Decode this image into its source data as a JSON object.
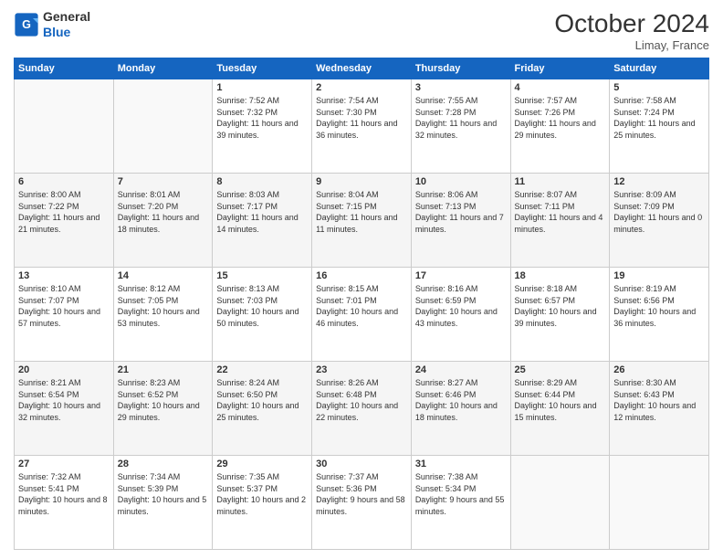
{
  "header": {
    "logo_line1": "General",
    "logo_line2": "Blue",
    "month": "October 2024",
    "location": "Limay, France"
  },
  "days_of_week": [
    "Sunday",
    "Monday",
    "Tuesday",
    "Wednesday",
    "Thursday",
    "Friday",
    "Saturday"
  ],
  "weeks": [
    [
      {
        "day": "",
        "sunrise": "",
        "sunset": "",
        "daylight": ""
      },
      {
        "day": "",
        "sunrise": "",
        "sunset": "",
        "daylight": ""
      },
      {
        "day": "1",
        "sunrise": "Sunrise: 7:52 AM",
        "sunset": "Sunset: 7:32 PM",
        "daylight": "Daylight: 11 hours and 39 minutes."
      },
      {
        "day": "2",
        "sunrise": "Sunrise: 7:54 AM",
        "sunset": "Sunset: 7:30 PM",
        "daylight": "Daylight: 11 hours and 36 minutes."
      },
      {
        "day": "3",
        "sunrise": "Sunrise: 7:55 AM",
        "sunset": "Sunset: 7:28 PM",
        "daylight": "Daylight: 11 hours and 32 minutes."
      },
      {
        "day": "4",
        "sunrise": "Sunrise: 7:57 AM",
        "sunset": "Sunset: 7:26 PM",
        "daylight": "Daylight: 11 hours and 29 minutes."
      },
      {
        "day": "5",
        "sunrise": "Sunrise: 7:58 AM",
        "sunset": "Sunset: 7:24 PM",
        "daylight": "Daylight: 11 hours and 25 minutes."
      }
    ],
    [
      {
        "day": "6",
        "sunrise": "Sunrise: 8:00 AM",
        "sunset": "Sunset: 7:22 PM",
        "daylight": "Daylight: 11 hours and 21 minutes."
      },
      {
        "day": "7",
        "sunrise": "Sunrise: 8:01 AM",
        "sunset": "Sunset: 7:20 PM",
        "daylight": "Daylight: 11 hours and 18 minutes."
      },
      {
        "day": "8",
        "sunrise": "Sunrise: 8:03 AM",
        "sunset": "Sunset: 7:17 PM",
        "daylight": "Daylight: 11 hours and 14 minutes."
      },
      {
        "day": "9",
        "sunrise": "Sunrise: 8:04 AM",
        "sunset": "Sunset: 7:15 PM",
        "daylight": "Daylight: 11 hours and 11 minutes."
      },
      {
        "day": "10",
        "sunrise": "Sunrise: 8:06 AM",
        "sunset": "Sunset: 7:13 PM",
        "daylight": "Daylight: 11 hours and 7 minutes."
      },
      {
        "day": "11",
        "sunrise": "Sunrise: 8:07 AM",
        "sunset": "Sunset: 7:11 PM",
        "daylight": "Daylight: 11 hours and 4 minutes."
      },
      {
        "day": "12",
        "sunrise": "Sunrise: 8:09 AM",
        "sunset": "Sunset: 7:09 PM",
        "daylight": "Daylight: 11 hours and 0 minutes."
      }
    ],
    [
      {
        "day": "13",
        "sunrise": "Sunrise: 8:10 AM",
        "sunset": "Sunset: 7:07 PM",
        "daylight": "Daylight: 10 hours and 57 minutes."
      },
      {
        "day": "14",
        "sunrise": "Sunrise: 8:12 AM",
        "sunset": "Sunset: 7:05 PM",
        "daylight": "Daylight: 10 hours and 53 minutes."
      },
      {
        "day": "15",
        "sunrise": "Sunrise: 8:13 AM",
        "sunset": "Sunset: 7:03 PM",
        "daylight": "Daylight: 10 hours and 50 minutes."
      },
      {
        "day": "16",
        "sunrise": "Sunrise: 8:15 AM",
        "sunset": "Sunset: 7:01 PM",
        "daylight": "Daylight: 10 hours and 46 minutes."
      },
      {
        "day": "17",
        "sunrise": "Sunrise: 8:16 AM",
        "sunset": "Sunset: 6:59 PM",
        "daylight": "Daylight: 10 hours and 43 minutes."
      },
      {
        "day": "18",
        "sunrise": "Sunrise: 8:18 AM",
        "sunset": "Sunset: 6:57 PM",
        "daylight": "Daylight: 10 hours and 39 minutes."
      },
      {
        "day": "19",
        "sunrise": "Sunrise: 8:19 AM",
        "sunset": "Sunset: 6:56 PM",
        "daylight": "Daylight: 10 hours and 36 minutes."
      }
    ],
    [
      {
        "day": "20",
        "sunrise": "Sunrise: 8:21 AM",
        "sunset": "Sunset: 6:54 PM",
        "daylight": "Daylight: 10 hours and 32 minutes."
      },
      {
        "day": "21",
        "sunrise": "Sunrise: 8:23 AM",
        "sunset": "Sunset: 6:52 PM",
        "daylight": "Daylight: 10 hours and 29 minutes."
      },
      {
        "day": "22",
        "sunrise": "Sunrise: 8:24 AM",
        "sunset": "Sunset: 6:50 PM",
        "daylight": "Daylight: 10 hours and 25 minutes."
      },
      {
        "day": "23",
        "sunrise": "Sunrise: 8:26 AM",
        "sunset": "Sunset: 6:48 PM",
        "daylight": "Daylight: 10 hours and 22 minutes."
      },
      {
        "day": "24",
        "sunrise": "Sunrise: 8:27 AM",
        "sunset": "Sunset: 6:46 PM",
        "daylight": "Daylight: 10 hours and 18 minutes."
      },
      {
        "day": "25",
        "sunrise": "Sunrise: 8:29 AM",
        "sunset": "Sunset: 6:44 PM",
        "daylight": "Daylight: 10 hours and 15 minutes."
      },
      {
        "day": "26",
        "sunrise": "Sunrise: 8:30 AM",
        "sunset": "Sunset: 6:43 PM",
        "daylight": "Daylight: 10 hours and 12 minutes."
      }
    ],
    [
      {
        "day": "27",
        "sunrise": "Sunrise: 7:32 AM",
        "sunset": "Sunset: 5:41 PM",
        "daylight": "Daylight: 10 hours and 8 minutes."
      },
      {
        "day": "28",
        "sunrise": "Sunrise: 7:34 AM",
        "sunset": "Sunset: 5:39 PM",
        "daylight": "Daylight: 10 hours and 5 minutes."
      },
      {
        "day": "29",
        "sunrise": "Sunrise: 7:35 AM",
        "sunset": "Sunset: 5:37 PM",
        "daylight": "Daylight: 10 hours and 2 minutes."
      },
      {
        "day": "30",
        "sunrise": "Sunrise: 7:37 AM",
        "sunset": "Sunset: 5:36 PM",
        "daylight": "Daylight: 9 hours and 58 minutes."
      },
      {
        "day": "31",
        "sunrise": "Sunrise: 7:38 AM",
        "sunset": "Sunset: 5:34 PM",
        "daylight": "Daylight: 9 hours and 55 minutes."
      },
      {
        "day": "",
        "sunrise": "",
        "sunset": "",
        "daylight": ""
      },
      {
        "day": "",
        "sunrise": "",
        "sunset": "",
        "daylight": ""
      }
    ]
  ]
}
